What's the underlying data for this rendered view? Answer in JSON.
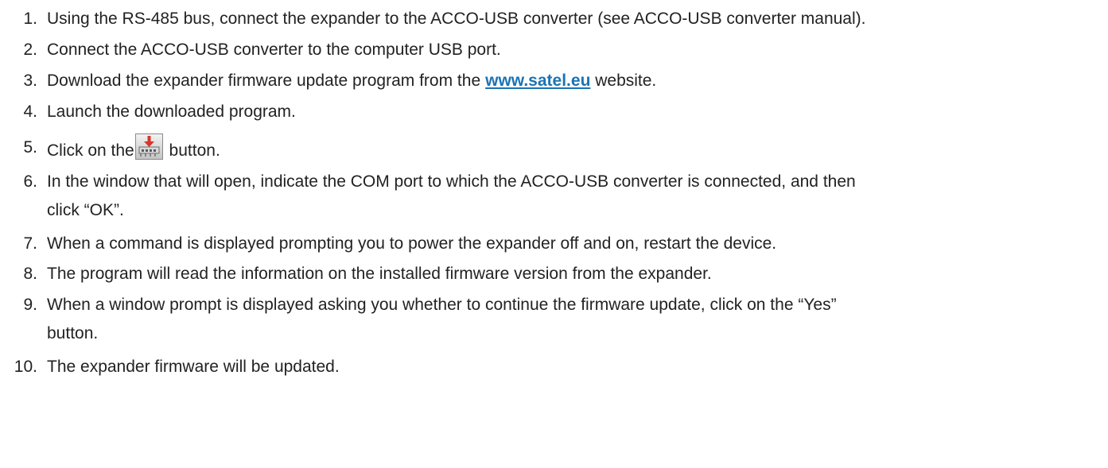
{
  "steps": [
    {
      "num": "1.",
      "text": "Using the RS-485 bus, connect the expander to the ACCO-USB converter (see ACCO-USB converter manual)."
    },
    {
      "num": "2.",
      "text": "Connect the ACCO-USB converter to the computer USB port."
    },
    {
      "num": "3.",
      "before": "Download the expander firmware update program from the",
      "link": "www.satel.eu",
      "after": " website."
    },
    {
      "num": "4.",
      "text": "Launch the downloaded program."
    },
    {
      "num": "5.",
      "before": "Click on the",
      "icon": "firmware-update-icon",
      "after": " button."
    },
    {
      "num": "6.",
      "text": "In the window that will open, indicate the COM port to which the ACCO-USB converter is connected, and then",
      "cont": "click “OK”."
    },
    {
      "num": "7.",
      "text": "When a command is displayed prompting you to power the expander off and on, restart the device."
    },
    {
      "num": "8.",
      "text": "The program will read the information on the installed firmware version from the expander."
    },
    {
      "num": "9.",
      "text": "When a window prompt is displayed asking you whether to continue the firmware update, click on the “Yes”",
      "cont": "button."
    },
    {
      "num": "10.",
      "text": "The expander firmware will be updated."
    }
  ],
  "colors": {
    "text": "#222222",
    "link": "#1a73b5",
    "icon_arrow": "#d8352a"
  }
}
